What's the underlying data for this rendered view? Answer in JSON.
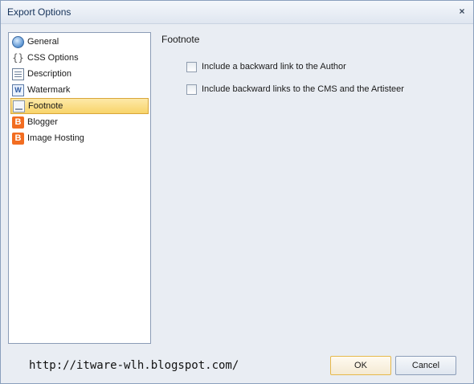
{
  "window": {
    "title": "Export Options",
    "close_symbol": "×"
  },
  "sidebar": {
    "items": [
      {
        "label": "General",
        "icon": "globe-icon"
      },
      {
        "label": "CSS Options",
        "icon": "css-braces-icon"
      },
      {
        "label": "Description",
        "icon": "document-icon"
      },
      {
        "label": "Watermark",
        "icon": "watermark-icon"
      },
      {
        "label": "Footnote",
        "icon": "footnote-icon",
        "selected": true
      },
      {
        "label": "Blogger",
        "icon": "blogger-icon"
      },
      {
        "label": "Image Hosting",
        "icon": "blogger-icon"
      }
    ]
  },
  "content": {
    "title": "Footnote",
    "options": [
      {
        "label": "Include a backward link to the Author",
        "checked": false
      },
      {
        "label": "Include backward links to the CMS and the Artisteer",
        "checked": false
      }
    ]
  },
  "footer": {
    "url_text": "http://itware-wlh.blogspot.com/",
    "ok_label": "OK",
    "cancel_label": "Cancel"
  },
  "colors": {
    "selection": "#f8d46a",
    "blogger_orange": "#f26d21",
    "window_bg": "#e9edf3"
  }
}
